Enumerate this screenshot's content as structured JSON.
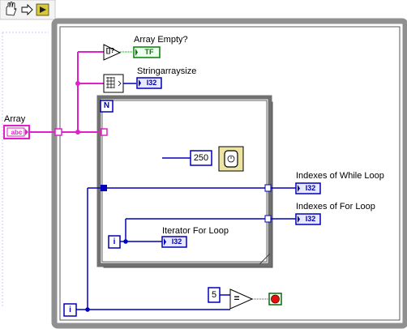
{
  "toolbar": {
    "run_button_icon": "hand-icon",
    "step_icon": "arrow-right-icon",
    "highlight_icon": "bulb-icon"
  },
  "controls": {
    "array_label": "Array",
    "array_type": "abc"
  },
  "indicators": {
    "array_empty_label": "Array Empty?",
    "array_empty_type": "TF",
    "string_array_size_label": "Stringarraysize",
    "string_array_size_type": "I32",
    "while_index_label": "Indexes of While Loop",
    "while_index_type": "I32",
    "for_index_label": "Indexes of For Loop",
    "for_index_type": "I32",
    "iterator_for_label": "Iterator For Loop",
    "iterator_for_type": "I32"
  },
  "nodes": {
    "empty_fn_text": "[]?",
    "for_count_terminal": "N",
    "for_iter_terminal": "i",
    "while_iter_terminal": "i",
    "wait_ms_value": "250",
    "compare_value": "5",
    "equal_symbol": "="
  },
  "colors": {
    "string_wire": "#e020c8",
    "int_wire": "#0000b8",
    "bool_wire": "#008000",
    "while_frame": "#8c8c8c",
    "for_frame": "#707070",
    "stop_button": "#e01010"
  }
}
